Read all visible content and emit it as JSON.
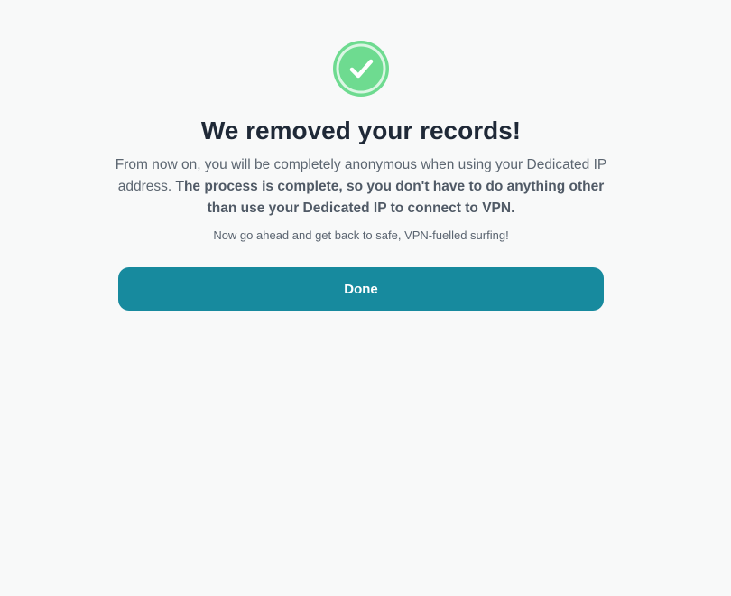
{
  "success": {
    "icon": "check-circle-icon",
    "icon_color": "#6edb90"
  },
  "title": "We removed your records!",
  "description": {
    "normal": "From now on, you will be completely anonymous when using your Dedicated IP address. ",
    "bold": "The process is complete, so you don't have to do anything other than use your Dedicated IP to connect to VPN."
  },
  "subnote": "Now go ahead and get back to safe, VPN-fuelled surfing!",
  "done_button": {
    "label": "Done",
    "color": "#178a9e"
  }
}
